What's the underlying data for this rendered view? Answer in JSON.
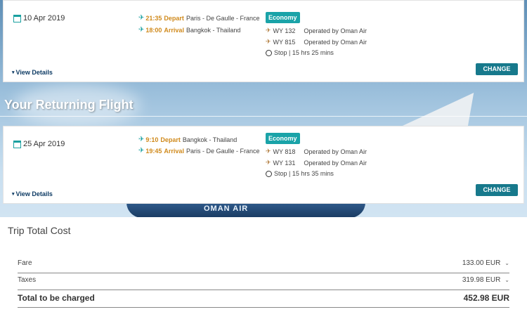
{
  "outbound": {
    "date": "10 Apr 2019",
    "depart": {
      "time": "21:35",
      "kind": "Depart",
      "place": "Paris - De Gaulle - France"
    },
    "arrival": {
      "time": "18:00",
      "kind": "Arrival",
      "place": "Bangkok - Thailand"
    },
    "cabin": "Economy",
    "flights": [
      {
        "code": "WY 132",
        "operator": "Operated by Oman Air"
      },
      {
        "code": "WY 815",
        "operator": "Operated by Oman Air"
      }
    ],
    "stop": "Stop | 15 hrs 25 mins",
    "details_label": "View Details",
    "change_label": "CHANGE"
  },
  "section_title": "Your Returning Flight",
  "banner_text": "OMAN AIR",
  "return": {
    "date": "25 Apr 2019",
    "depart": {
      "time": "9:10",
      "kind": "Depart",
      "place": "Bangkok - Thailand"
    },
    "arrival": {
      "time": "19:45",
      "kind": "Arrival",
      "place": "Paris - De Gaulle - France"
    },
    "cabin": "Economy",
    "flights": [
      {
        "code": "WY 818",
        "operator": "Operated by Oman Air"
      },
      {
        "code": "WY 131",
        "operator": "Operated by Oman Air"
      }
    ],
    "stop": "Stop | 15 hrs 35 mins",
    "details_label": "View Details",
    "change_label": "CHANGE"
  },
  "cost": {
    "title": "Trip Total Cost",
    "fare": {
      "label": "Fare",
      "value": "133.00 EUR"
    },
    "taxes": {
      "label": "Taxes",
      "value": "319.98 EUR"
    },
    "total": {
      "label": "Total to be charged",
      "value": "452.98 EUR"
    }
  },
  "colors": {
    "accent": "#1aa3a8",
    "button": "#17798c",
    "time": "#d08a1c",
    "link": "#0e3b64"
  }
}
